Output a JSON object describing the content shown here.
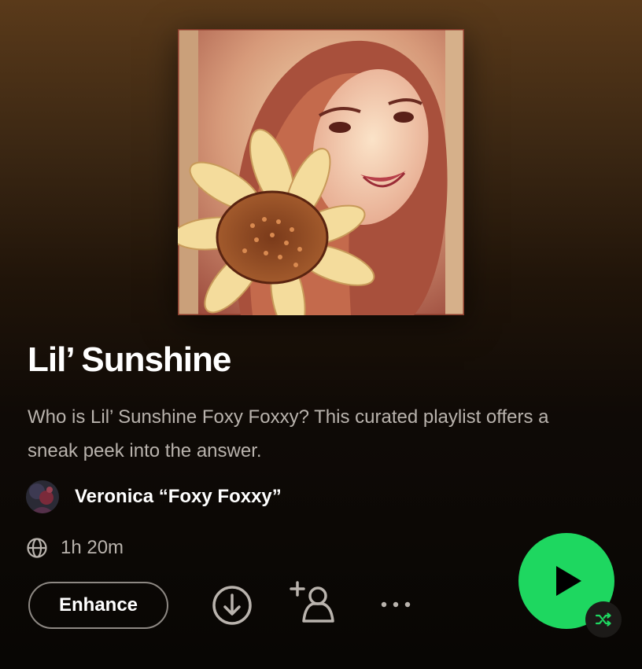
{
  "playlist": {
    "title": "Lil’ Sunshine",
    "description": "Who is Lil’ Sunshine Foxy Foxxy? This curated playlist offers a sneak peek into the answer.",
    "owner_name": "Veronica “Foxy Foxxy”",
    "duration": "1h 20m",
    "visibility_icon": "globe-icon"
  },
  "actions": {
    "enhance_label": "Enhance",
    "download_icon": "download-icon",
    "add_collaborator_icon": "add-user-icon",
    "more_icon": "more-icon",
    "play_icon": "play-icon",
    "shuffle_icon": "shuffle-icon"
  },
  "colors": {
    "accent_green": "#1ed760",
    "text_secondary": "#b9b3ad",
    "background_top": "#5a3a1a",
    "background_bottom": "#080604"
  }
}
